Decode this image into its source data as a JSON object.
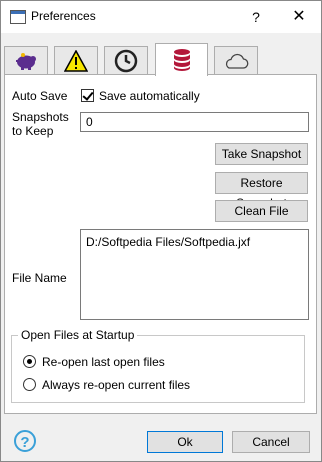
{
  "window": {
    "title": "Preferences"
  },
  "titlebar": {
    "help": "?",
    "close": "✕"
  },
  "tabs": [
    {
      "icon": "piggy-bank-icon",
      "active": false
    },
    {
      "icon": "warning-icon",
      "active": false
    },
    {
      "icon": "clock-icon",
      "active": false
    },
    {
      "icon": "database-icon",
      "active": true
    },
    {
      "icon": "cloud-icon",
      "active": false
    }
  ],
  "autosave": {
    "label": "Auto Save",
    "checkbox_label": "Save automatically",
    "checked": true
  },
  "snapshots": {
    "label": "Snapshots to Keep",
    "value": "0"
  },
  "buttons": {
    "take_snapshot": "Take Snapshot",
    "restore_snapshot": "Restore Snapshot",
    "clean_file": "Clean File"
  },
  "file": {
    "label": "File Name",
    "value": "D:/Softpedia Files/Softpedia.jxf"
  },
  "startup": {
    "title": "Open Files at Startup",
    "options": [
      {
        "label": "Re-open last open files",
        "selected": true
      },
      {
        "label": "Always re-open current files",
        "selected": false
      }
    ]
  },
  "footer": {
    "help": "?",
    "ok": "Ok",
    "cancel": "Cancel"
  },
  "colors": {
    "accent": "#0078d7",
    "help_icon": "#3aa0d8",
    "database_icon": "#b3173a"
  }
}
